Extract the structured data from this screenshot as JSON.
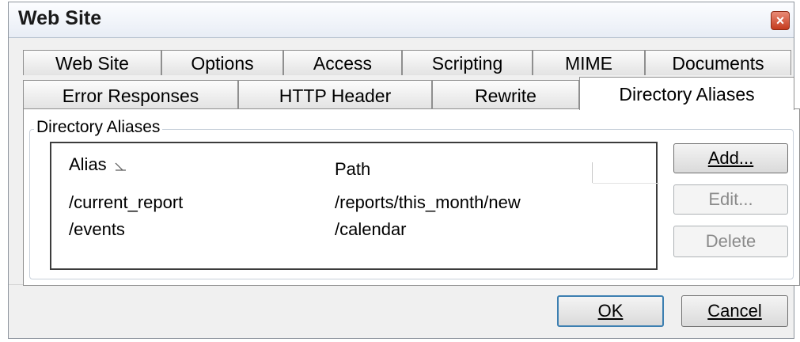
{
  "window": {
    "title": "Web Site",
    "close_glyph": "×"
  },
  "tabs_row1": [
    {
      "label": "Web Site"
    },
    {
      "label": "Options"
    },
    {
      "label": "Access"
    },
    {
      "label": "Scripting"
    },
    {
      "label": "MIME"
    },
    {
      "label": "Documents"
    }
  ],
  "tabs_row2": [
    {
      "label": "Error Responses"
    },
    {
      "label": "HTTP Header"
    },
    {
      "label": "Rewrite"
    },
    {
      "label": "Directory Aliases",
      "selected": true
    }
  ],
  "group": {
    "label": "Directory Aliases"
  },
  "list": {
    "columns": [
      {
        "label": "Alias",
        "sort": "ascending"
      },
      {
        "label": "Path"
      }
    ],
    "rows": [
      {
        "alias": "/current_report",
        "path": "/reports/this_month/new"
      },
      {
        "alias": "/events",
        "path": "/calendar"
      }
    ]
  },
  "side_buttons": {
    "add": "Add...",
    "edit": "Edit...",
    "delete": "Delete"
  },
  "footer": {
    "ok_label": "OK",
    "cancel_label": "Cancel"
  },
  "colors": {
    "title_bg": "#e8edf5",
    "close_red": "#c43b1e",
    "default_border": "#3c7fb1"
  }
}
